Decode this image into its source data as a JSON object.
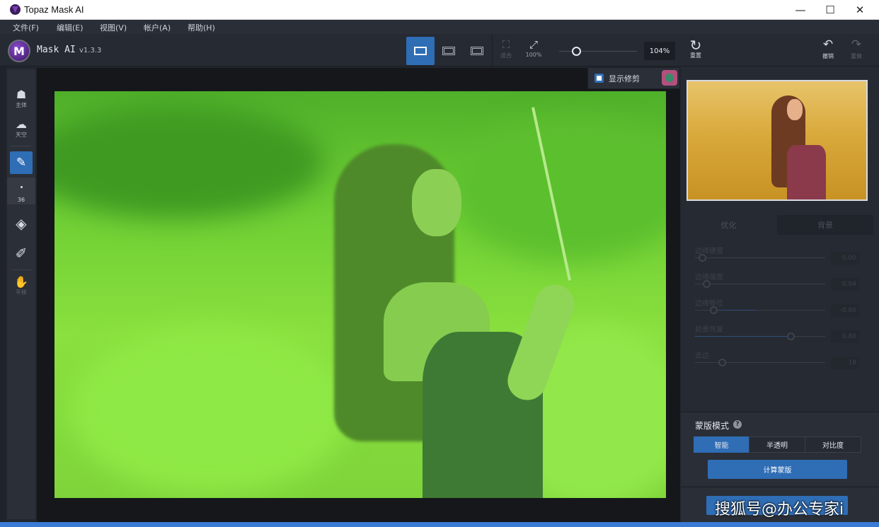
{
  "window": {
    "title": "Topaz Mask AI",
    "controls": [
      "—",
      "☐",
      "✕"
    ]
  },
  "menu": [
    "文件(F)",
    "编辑(E)",
    "视图(V)",
    "帐户(A)",
    "帮助(H)"
  ],
  "app": {
    "name": "Mask AI",
    "version": "v1.3.3"
  },
  "toolbar": {
    "fit_label": "适合",
    "full_label": "100%",
    "zoom_value": "104%",
    "reset_label": "重置",
    "undo_label": "撤销",
    "redo_label": "重做",
    "zoom_level": 0.2
  },
  "tools": {
    "subject_label": "主体",
    "sky_label": "天空",
    "brush_size": "36",
    "pan_label": "平移"
  },
  "crop_popup": {
    "label": "显示修剪",
    "checked": true
  },
  "right_panel": {
    "tabs": [
      "优化",
      "背景"
    ],
    "sliders": [
      {
        "label": "边缘硬度",
        "value": "0.00",
        "level": 0.0
      },
      {
        "label": "边缘强度",
        "value": "0.04",
        "level": 0.04
      },
      {
        "label": "边缘移位",
        "value": "-0.80",
        "level": 0.1
      },
      {
        "label": "前景恢复",
        "value": "0.80",
        "level": 0.9
      },
      {
        "label": "去边",
        "value": "18",
        "level": 0.18
      }
    ],
    "mask_mode_title": "蒙版模式",
    "mask_modes": [
      "智能",
      "半透明",
      "对比度"
    ],
    "compute_label": "计算蒙版"
  },
  "watermark": "搜狐号@办公专家i",
  "colors": {
    "accent": "#2f6db5",
    "overlay_green": "#7fd93b"
  }
}
